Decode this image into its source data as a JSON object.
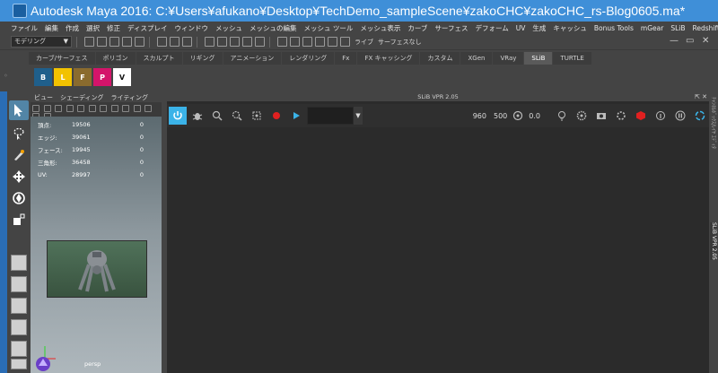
{
  "window": {
    "title": "Autodesk Maya 2016: C:¥Users¥afukano¥Desktop¥TechDemo_sampleScene¥zakoCHC¥zakoCHC_rs-Blog0605.ma*",
    "minimize": "—",
    "restore": "▭",
    "close": "✕"
  },
  "menubar": {
    "items": [
      "ファイル",
      "編集",
      "作成",
      "選択",
      "修正",
      "ディスプレイ",
      "ウィンドウ",
      "メッシュ",
      "メッシュの編集",
      "メッシュ ツール",
      "メッシュ表示",
      "カーブ",
      "サーフェス",
      "デフォーム",
      "UV",
      "生成",
      "キャッシュ",
      "Bonus Tools",
      "mGear",
      "SLiB",
      "Redshift",
      "ヘルプ"
    ]
  },
  "statusline": {
    "mode": "モデリング",
    "live_label": "ライブ",
    "live_value": "サーフェスなし"
  },
  "shelf": {
    "tabs": [
      "カーブ/サーフェス",
      "ポリゴン",
      "スカルプト",
      "リギング",
      "アニメーション",
      "レンダリング",
      "Fx",
      "FX キャッシング",
      "カスタム",
      "XGen",
      "VRay",
      "SLiB",
      "TURTLE"
    ],
    "active_tab": "SLiB",
    "buttons": [
      {
        "label": "B",
        "color": "#1f5f8b"
      },
      {
        "label": "L",
        "color": "#f2c200"
      },
      {
        "label": "F",
        "color": "#8a6b2e"
      },
      {
        "label": "P",
        "color": "#d4146a"
      },
      {
        "label": "V",
        "color": "#ffffff"
      }
    ]
  },
  "viewport": {
    "menu": [
      "ビュー",
      "シェーディング",
      "ライティング"
    ],
    "hud": [
      {
        "label": "頂点:",
        "value": "19506",
        "sel": "0"
      },
      {
        "label": "エッジ:",
        "value": "39061",
        "sel": "0"
      },
      {
        "label": "フェース:",
        "value": "19945",
        "sel": "0"
      },
      {
        "label": "三角形:",
        "value": "36458",
        "sel": "0"
      },
      {
        "label": "UV:",
        "value": "28997",
        "sel": "0"
      }
    ],
    "camera": "persp"
  },
  "vpr": {
    "title": "SLiB VPR 2.05",
    "width": "960",
    "height": "500",
    "exposure": "0.0"
  },
  "side_tabs": [
    "ﾁｬﾝﾈﾙﾎﾞｯｸｽ/ﾚｲﾔ ｴﾃﾞｨﾀ",
    "SLiB VPR 2.05"
  ],
  "colors": {
    "titlebar": "#3f8fd8",
    "accent": "#3bb3e8",
    "record": "#e02020"
  }
}
